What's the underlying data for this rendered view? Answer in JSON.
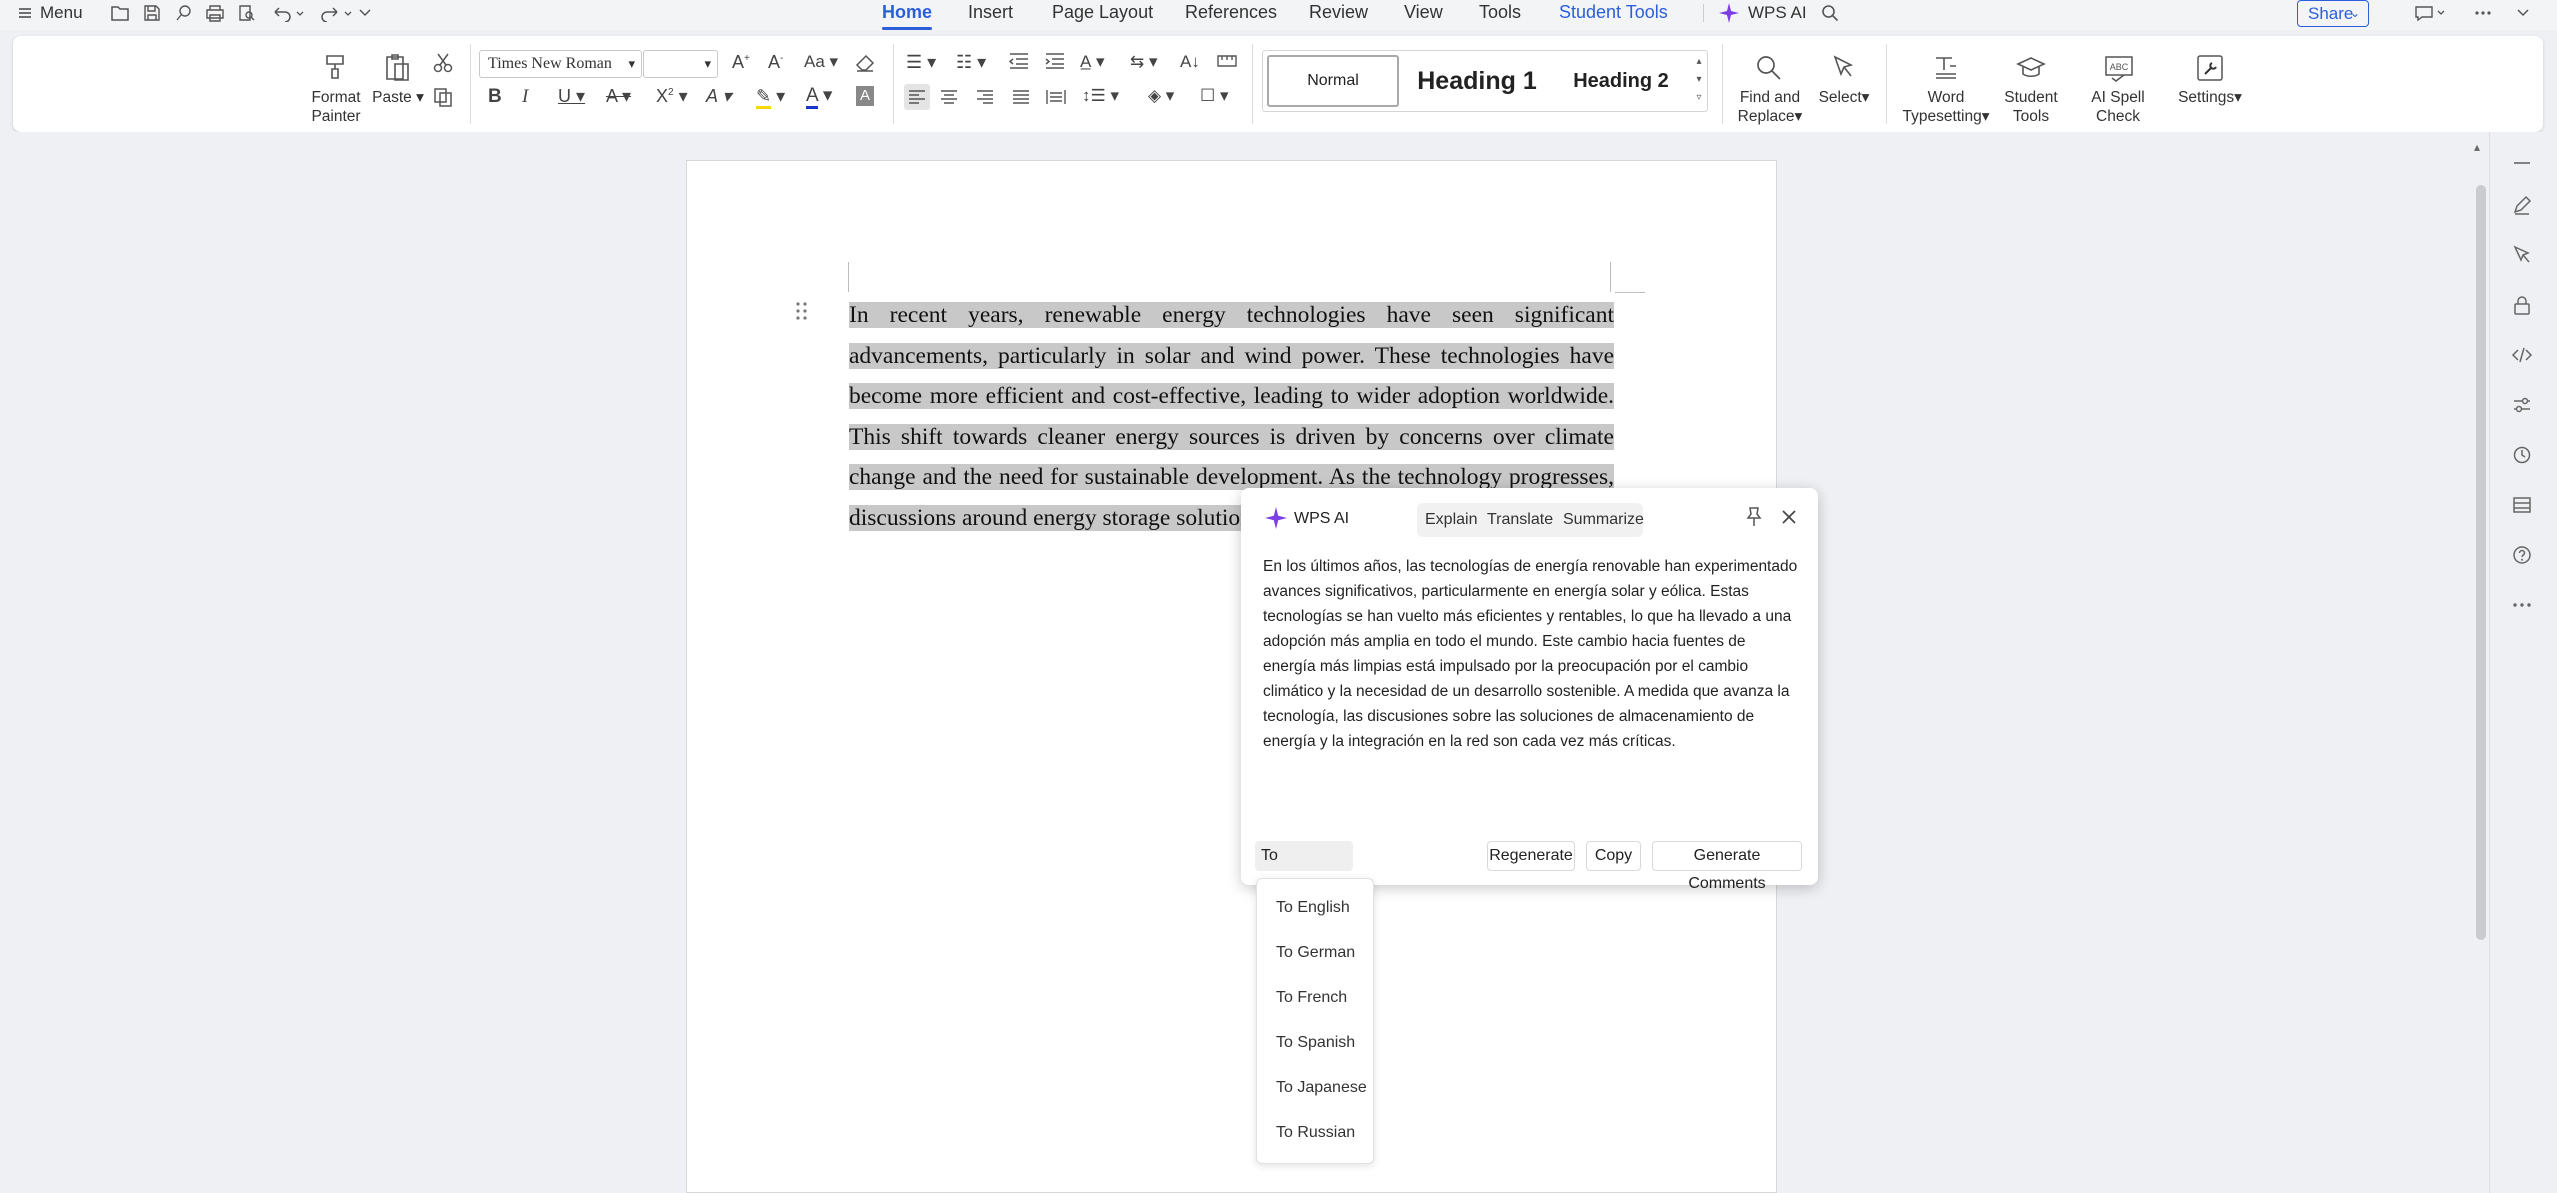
{
  "topbar": {
    "menu_label": "Menu",
    "tabs": [
      {
        "label": "Home",
        "active": true
      },
      {
        "label": "Insert"
      },
      {
        "label": "Page Layout"
      },
      {
        "label": "References"
      },
      {
        "label": "Review"
      },
      {
        "label": "View"
      },
      {
        "label": "Tools"
      },
      {
        "label": "Student Tools",
        "accent": true
      }
    ],
    "wps_ai_label": "WPS AI",
    "share_label": "Share"
  },
  "ribbon": {
    "format_painter": "Format Painter",
    "format_painter_l1": "Format",
    "format_painter_l2": "Painter",
    "paste": "Paste",
    "font_name": "Times New Roman",
    "font_size": "",
    "styles": {
      "normal": "Normal",
      "heading1": "Heading 1",
      "heading2": "Heading 2"
    },
    "find_replace_l1": "Find and",
    "find_replace_l2": "Replace",
    "select": "Select",
    "word_typesetting_l1": "Word",
    "word_typesetting_l2": "Typesetting",
    "student_tools_l1": "Student",
    "student_tools_l2": "Tools",
    "ai_spell_check": "AI Spell Check",
    "settings": "Settings"
  },
  "document": {
    "paragraph": "In recent years, renewable energy technologies have seen significant advancements, particularly in solar and wind power. These technologies have become more efficient and cost-effective, leading to wider adoption worldwide. This shift towards cleaner energy sources is driven by concerns over climate change and the need for sustainable development. As the technology progresses, discussions around energy storage solutions and grid integration are becoming"
  },
  "ai_panel": {
    "title": "WPS AI",
    "tabs": [
      "Explain",
      "Translate",
      "Summarize"
    ],
    "result_text": "En los últimos años, las tecnologías de energía renovable han experimentado avances significativos, particularmente en energía solar y eólica. Estas tecnologías se han vuelto más eficientes y rentables, lo que ha llevado a una adopción más amplia en todo el mundo. Este cambio hacia fuentes de energía más limpias está impulsado por la preocupación por el cambio climático y la necesidad de un desarrollo sostenible. A medida que avanza la tecnología, las discusiones sobre las soluciones de almacenamiento de energía y la integración en la red son cada vez más críticas.",
    "language_selected": "To Spanish",
    "buttons": {
      "regenerate": "Regenerate",
      "copy": "Copy",
      "generate_comments": "Generate Comments"
    },
    "language_options": [
      "To English",
      "To German",
      "To French",
      "To Spanish",
      "To Japanese",
      "To Russian"
    ]
  },
  "colors": {
    "accent": "#2b5fd9",
    "ai_purple": "#7b3fe4",
    "highlight": "#c8c8c8"
  }
}
